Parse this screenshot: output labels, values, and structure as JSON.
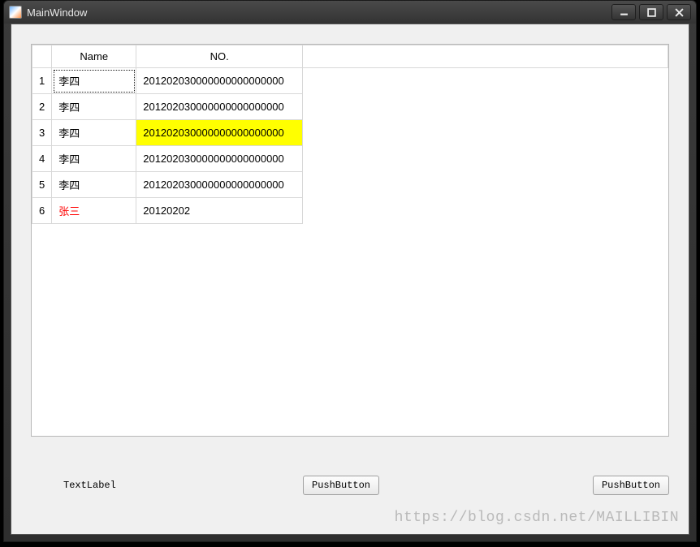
{
  "window": {
    "title": "MainWindow"
  },
  "table": {
    "columns": [
      "Name",
      "NO."
    ],
    "rows": [
      {
        "index": "1",
        "name": "李四",
        "no": "201202030000000000000000",
        "selectedCell": "name"
      },
      {
        "index": "2",
        "name": "李四",
        "no": "201202030000000000000000"
      },
      {
        "index": "3",
        "name": "李四",
        "no": "201202030000000000000000",
        "highlightCell": "no"
      },
      {
        "index": "4",
        "name": "李四",
        "no": "201202030000000000000000"
      },
      {
        "index": "5",
        "name": "李四",
        "no": "201202030000000000000000"
      },
      {
        "index": "6",
        "name": "张三",
        "no": "20120202",
        "nameColor": "red"
      }
    ]
  },
  "footer": {
    "label": "TextLabel",
    "button1": "PushButton",
    "button2": "PushButton"
  },
  "watermark": "https://blog.csdn.net/MAILLIBIN"
}
